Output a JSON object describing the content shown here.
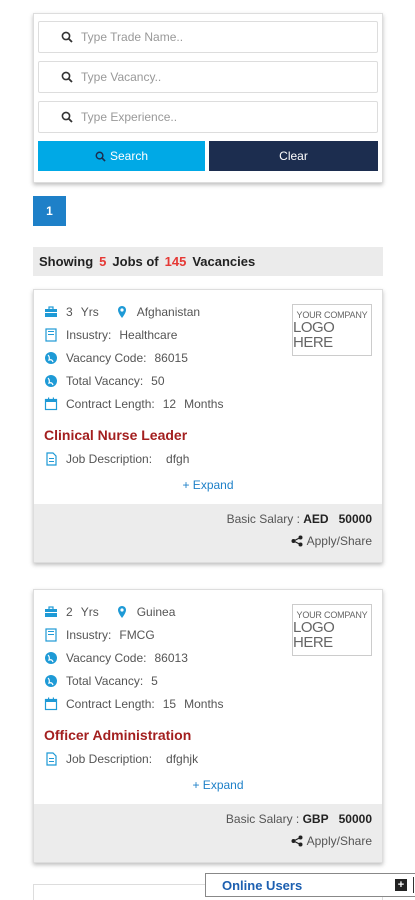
{
  "search": {
    "trade_placeholder": "Type Trade Name..",
    "vacancy_placeholder": "Type Vacancy..",
    "experience_placeholder": "Type Experience..",
    "search_label": "Search",
    "clear_label": "Clear"
  },
  "pagination": {
    "current_page": "1"
  },
  "summary": {
    "showing": "Showing",
    "jobs_count": "5",
    "jobs_of": "Jobs of",
    "vacancies_count": "145",
    "vacancies": "Vacancies"
  },
  "logo": {
    "line1": "YOUR COMPANY",
    "line2": "LOGO HERE"
  },
  "labels": {
    "yrs": "Yrs",
    "industry": "Insustry:",
    "vacancy_code": "Vacancy Code:",
    "total_vacancy": "Total Vacancy:",
    "contract_length": "Contract Length:",
    "months": "Months",
    "job_description": "Job Description:",
    "expand": "+ Expand",
    "basic_salary": "Basic Salary :",
    "apply_share": "Apply/Share"
  },
  "jobs": [
    {
      "years": "3",
      "country": "Afghanistan",
      "industry": "Healthcare",
      "vacancy_code": "86015",
      "total_vacancy": "50",
      "contract_months": "12",
      "title": "Clinical Nurse Leader",
      "description": "dfgh",
      "currency": "AED",
      "salary": "50000"
    },
    {
      "years": "2",
      "country": "Guinea",
      "industry": "FMCG",
      "vacancy_code": "86013",
      "total_vacancy": "5",
      "contract_months": "15",
      "title": "Officer Administration",
      "description": "dfghjk",
      "currency": "GBP",
      "salary": "50000"
    }
  ],
  "online_users": {
    "label": "Online Users",
    "toggle": "+"
  },
  "colors": {
    "search_button": "#00a9e6",
    "clear_button": "#1c2d4f",
    "pager": "#1e80c8",
    "job_title": "#a31f1f",
    "highlight": "#e53935",
    "icon_blue": "#1e9ad6"
  }
}
